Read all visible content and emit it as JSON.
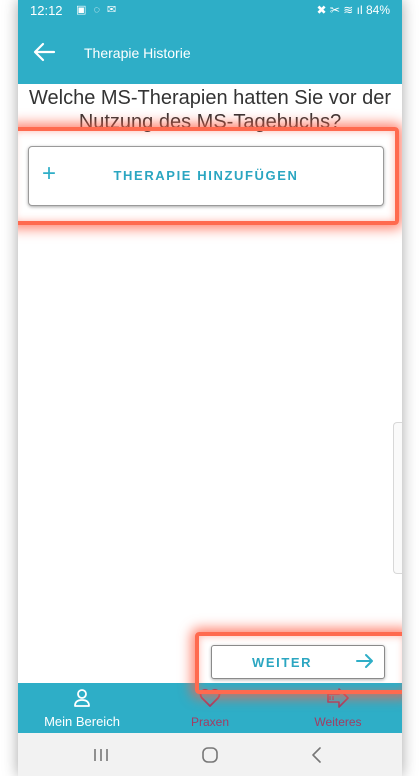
{
  "status_bar": {
    "time": "12:12",
    "notification_icons": "▣ ◌ ✉",
    "right_text": "✖ ✂ ≋ ıl 84%"
  },
  "app_bar": {
    "title": "Therapie Historie"
  },
  "question": {
    "line1": "Welche MS-Therapien hatten Sie vor der",
    "line2": "Nutzung des MS-Tagebuchs?"
  },
  "add_button": {
    "plus": "+",
    "label": "THERAPIE HINZUFÜGEN"
  },
  "next_button": {
    "label": "WEITER"
  },
  "bottom_nav": {
    "items": [
      {
        "label": "Mein Bereich",
        "icon": "person-icon",
        "active": true
      },
      {
        "label": "Praxen",
        "icon": "heart-icon",
        "active": false
      },
      {
        "label": "Weiteres",
        "icon": "arrow-right-outline-icon",
        "active": false
      }
    ]
  },
  "colors": {
    "primary": "#2eaec7",
    "inactive_nav": "#a23c63",
    "highlight": "#ff6a4f"
  }
}
